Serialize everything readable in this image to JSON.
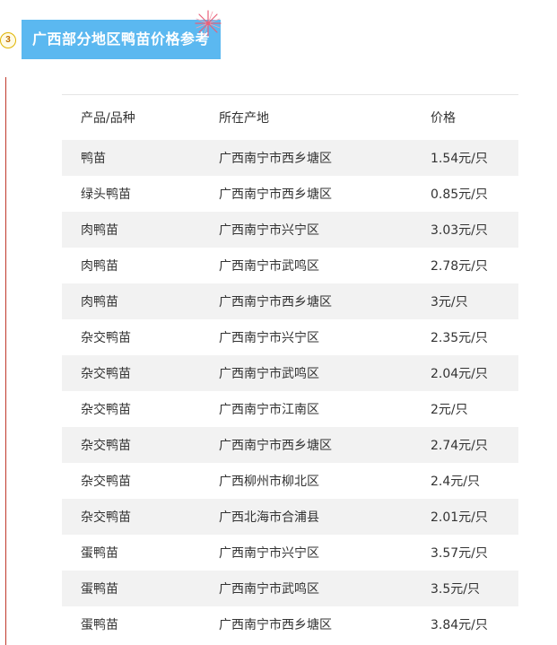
{
  "section": {
    "step_number": "3",
    "title": "广西部分地区鸭苗价格参考"
  },
  "table": {
    "headers": [
      "产品/品种",
      "所在产地",
      "价格"
    ],
    "rows": [
      [
        "鸭苗",
        "广西南宁市西乡塘区",
        "1.54元/只"
      ],
      [
        "绿头鸭苗",
        "广西南宁市西乡塘区",
        "0.85元/只"
      ],
      [
        "肉鸭苗",
        "广西南宁市兴宁区",
        "3.03元/只"
      ],
      [
        "肉鸭苗",
        "广西南宁市武鸣区",
        "2.78元/只"
      ],
      [
        "肉鸭苗",
        "广西南宁市西乡塘区",
        "3元/只"
      ],
      [
        "杂交鸭苗",
        "广西南宁市兴宁区",
        "2.35元/只"
      ],
      [
        "杂交鸭苗",
        "广西南宁市武鸣区",
        "2.04元/只"
      ],
      [
        "杂交鸭苗",
        "广西南宁市江南区",
        "2元/只"
      ],
      [
        "杂交鸭苗",
        "广西南宁市西乡塘区",
        "2.74元/只"
      ],
      [
        "杂交鸭苗",
        "广西柳州市柳北区",
        "2.4元/只"
      ],
      [
        "杂交鸭苗",
        "广西北海市合浦县",
        "2.01元/只"
      ],
      [
        "蛋鸭苗",
        "广西南宁市兴宁区",
        "3.57元/只"
      ],
      [
        "蛋鸭苗",
        "广西南宁市武鸣区",
        "3.5元/只"
      ],
      [
        "蛋鸭苗",
        "广西南宁市西乡塘区",
        "3.84元/只"
      ]
    ]
  }
}
